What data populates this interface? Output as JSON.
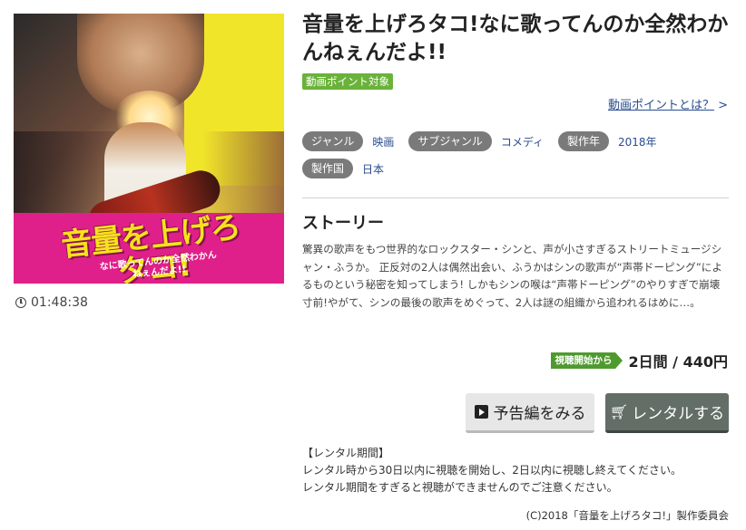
{
  "title": "音量を上げろタコ!なに歌ってんのか全然わかんねぇんだよ!!",
  "point_badge": "動画ポイント対象",
  "point_link": "動画ポイントとは？",
  "point_link_arrow": ">",
  "poster": {
    "logo_text": "音量を上げろタコ!",
    "sub_text": "なに歌ってんのか全然わかんねぇんだよ!!"
  },
  "duration": "01:48:38",
  "meta": {
    "genre_label": "ジャンル",
    "genre_value": "映画",
    "subgenre_label": "サブジャンル",
    "subgenre_value": "コメディ",
    "year_label": "製作年",
    "year_value": "2018年",
    "country_label": "製作国",
    "country_value": "日本"
  },
  "story_heading": "ストーリー",
  "story_text": "驚異の歌声をもつ世界的なロックスター・シンと、声が小さすぎるストリートミュージシャン・ふうか。 正反対の2人は偶然出会い、ふうかはシンの歌声が“声帯ドーピング”によるものという秘密を知ってしまう! しかもシンの喉は“声帯ドーピング”のやりすぎで崩壊寸前!やがて、シンの最後の歌声をめぐって、2人は謎の組織から追われるはめに…。",
  "view_badge": "視聴開始から",
  "price": "2日間 / 440円",
  "buttons": {
    "trailer": "予告編をみる",
    "rental": "レンタルする"
  },
  "rental_notes": {
    "heading": "【レンタル期間】",
    "line1": "レンタル時から30日以内に視聴を開始し、2日以内に視聴し終えてください。",
    "line2": "レンタル期間をすぎると視聴ができませんのでご注意ください。"
  },
  "copyright": "(C)2018「音量を上げろタコ!」製作委員会",
  "icons": {
    "clock": "clock-icon",
    "play": "play-icon",
    "cart": "cart-icon"
  },
  "colors": {
    "badge_green": "#6ab23a",
    "view_badge_green": "#4f9a2f",
    "link_blue": "#2a4d8f",
    "pill_gray": "#7a7a7a",
    "rental_button": "#626e66"
  }
}
